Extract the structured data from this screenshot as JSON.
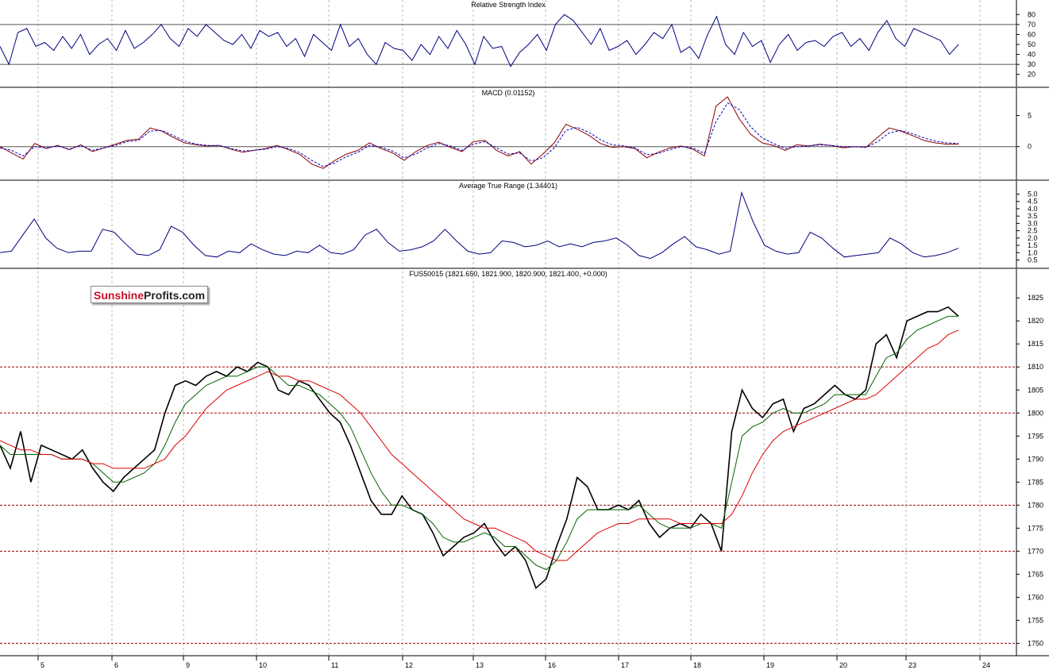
{
  "logo": {
    "part1": "Sunshine",
    "part2": "Profits.com"
  },
  "colors": {
    "price": "#000000",
    "sma_fast": "#006400",
    "sma_slow": "#dd0000",
    "rsi": "#000080",
    "macd": "#8b0000",
    "macd_signal": "#0000cc",
    "atr": "#000080",
    "grid": "#b8b8b8",
    "level": "#a00000",
    "frame": "#000000"
  },
  "chart_data": [
    {
      "type": "line",
      "title": "Relative Strength Index",
      "ylim": [
        15,
        85
      ],
      "y_ticks": [
        "80",
        "70",
        "60",
        "50",
        "40",
        "30",
        "20"
      ],
      "levels": [
        30,
        70
      ],
      "series": [
        {
          "values": [
            48,
            30,
            62,
            66,
            48,
            52,
            44,
            58,
            46,
            60,
            40,
            50,
            56,
            44,
            64,
            46,
            52,
            60,
            70,
            56,
            48,
            66,
            58,
            70,
            62,
            54,
            50,
            60,
            46,
            64,
            58,
            62,
            48,
            56,
            38,
            60,
            52,
            44,
            70,
            48,
            56,
            40,
            30,
            52,
            46,
            44,
            34,
            50,
            40,
            58,
            46,
            64,
            50,
            30,
            58,
            46,
            48,
            28,
            42,
            50,
            60,
            44,
            70,
            80,
            74,
            62,
            50,
            66,
            44,
            48,
            54,
            40,
            50,
            62,
            56,
            70,
            42,
            48,
            36,
            60,
            78,
            50,
            40,
            62,
            48,
            54,
            32,
            50,
            60,
            44,
            52,
            54,
            48,
            58,
            62,
            48,
            56,
            44,
            62,
            74,
            56,
            48,
            66,
            62,
            58,
            54,
            40,
            50
          ]
        }
      ]
    },
    {
      "type": "line",
      "title": "MACD (0.01152)",
      "ylim": [
        -4.5,
        8
      ],
      "y_ticks": [
        "5",
        "0"
      ],
      "levels": [
        0
      ],
      "series": [
        {
          "values": [
            0,
            -1,
            -2,
            0.5,
            -0.3,
            0.2,
            -0.5,
            0.3,
            -0.8,
            -0.2,
            0.4,
            1,
            1.2,
            3,
            2.5,
            1.5,
            0.6,
            0.3,
            0.1,
            0.2,
            -0.4,
            -0.9,
            -0.6,
            -0.3,
            0.2,
            -0.5,
            -1.3,
            -2.8,
            -3.5,
            -2.2,
            -1.2,
            -0.6,
            0.6,
            -0.3,
            -1,
            -2.2,
            -0.8,
            0.2,
            0.7,
            -0.1,
            -0.8,
            0.8,
            1,
            -0.6,
            -1.5,
            -0.8,
            -2.8,
            -1.2,
            0.6,
            3.6,
            2.8,
            1.8,
            0.5,
            -0.1,
            0,
            -0.3,
            -1.8,
            -0.9,
            -0.2,
            0.1,
            -0.4,
            -1.5,
            6.5,
            8,
            4.5,
            2,
            0.6,
            0.2,
            -0.6,
            0.3,
            0.1,
            0.4,
            0.2,
            -0.2,
            0,
            -0.1,
            1.5,
            3,
            2.5,
            1.8,
            1,
            0.6,
            0.4,
            0.4
          ]
        },
        {
          "values": [
            -0.2,
            -0.6,
            -1.5,
            0,
            -0.2,
            0.1,
            -0.4,
            0.2,
            -0.6,
            -0.2,
            0.2,
            0.8,
            1,
            2.5,
            2.6,
            1.8,
            0.9,
            0.4,
            0.2,
            0.2,
            -0.3,
            -0.7,
            -0.6,
            -0.4,
            0,
            -0.3,
            -1,
            -2.2,
            -3.2,
            -2.6,
            -1.6,
            -0.9,
            0.2,
            -0.1,
            -0.7,
            -1.8,
            -1.2,
            -0.2,
            0.5,
            0.1,
            -0.6,
            0.4,
            0.8,
            -0.2,
            -1.2,
            -1,
            -2.3,
            -1.8,
            -0.2,
            2.6,
            3.1,
            2.3,
            1.1,
            0.3,
            0.1,
            -0.2,
            -1.3,
            -1.1,
            -0.5,
            0,
            -0.2,
            -1.1,
            4,
            7,
            6,
            3.2,
            1.4,
            0.5,
            -0.3,
            0,
            0.1,
            0.3,
            0.2,
            0,
            0,
            -0.1,
            0.8,
            2.2,
            2.6,
            2.1,
            1.4,
            0.9,
            0.6,
            0.5
          ]
        }
      ]
    },
    {
      "type": "line",
      "title": "Average True Range (1.34401)",
      "ylim": [
        0.2,
        5.3
      ],
      "y_ticks": [
        "5.0",
        "4.5",
        "4.0",
        "3.5",
        "3.0",
        "2.5",
        "2.0",
        "1.5",
        "1.0",
        "0.5"
      ],
      "series": [
        {
          "values": [
            1.0,
            1.1,
            2.2,
            3.3,
            2.0,
            1.3,
            1.0,
            1.1,
            1.1,
            2.6,
            2.4,
            1.6,
            0.9,
            0.8,
            1.2,
            2.8,
            2.4,
            1.5,
            0.8,
            0.7,
            1.1,
            1.0,
            1.6,
            1.2,
            0.9,
            0.8,
            1.1,
            1.0,
            1.5,
            1.0,
            0.9,
            1.2,
            2.2,
            2.6,
            1.7,
            1.1,
            1.2,
            1.4,
            1.8,
            2.6,
            1.8,
            1.1,
            0.9,
            1.0,
            1.8,
            1.7,
            1.4,
            1.5,
            1.8,
            1.4,
            1.6,
            1.4,
            1.7,
            1.8,
            2.0,
            1.5,
            0.8,
            0.6,
            1.0,
            1.6,
            2.1,
            1.4,
            1.2,
            0.9,
            1.1,
            5.1,
            3.1,
            1.5,
            1.1,
            0.9,
            1.0,
            2.4,
            2.0,
            1.3,
            0.7,
            0.8,
            0.9,
            1.0,
            2.0,
            1.6,
            1.0,
            0.7,
            0.8,
            1.0,
            1.3
          ]
        }
      ]
    },
    {
      "type": "line",
      "title": "FUS50015 (1821.650, 1821.900, 1820.900, 1821.400, +0.000)",
      "ylim": [
        1748,
        1829
      ],
      "y_ticks": [
        "1825",
        "1820",
        "1815",
        "1810",
        "1805",
        "1800",
        "1795",
        "1790",
        "1785",
        "1780",
        "1775",
        "1770",
        "1765",
        "1760",
        "1755",
        "1750"
      ],
      "levels": [
        1810,
        1800,
        1780,
        1770,
        1750
      ],
      "x_ticks": [
        "5",
        "6",
        "9",
        "10",
        "11",
        "12",
        "13",
        "16",
        "17",
        "18",
        "19",
        "20",
        "23",
        "24"
      ],
      "series": [
        {
          "values": [
            1793,
            1788,
            1796,
            1785,
            1793,
            1792,
            1791,
            1790,
            1792,
            1788,
            1785,
            1783,
            1786,
            1788,
            1790,
            1792,
            1800,
            1806,
            1807,
            1806,
            1808,
            1809,
            1808,
            1810,
            1809,
            1811,
            1810,
            1805,
            1804,
            1807,
            1806,
            1803,
            1800,
            1798,
            1793,
            1787,
            1781,
            1778,
            1778,
            1782,
            1779,
            1778,
            1774,
            1769,
            1771,
            1773,
            1774,
            1776,
            1772,
            1769,
            1771,
            1768,
            1762,
            1764,
            1771,
            1777,
            1786,
            1784,
            1779,
            1779,
            1780,
            1779,
            1781,
            1776,
            1773,
            1775,
            1776,
            1775,
            1778,
            1776,
            1770,
            1796,
            1805,
            1801,
            1799,
            1802,
            1803,
            1796,
            1801,
            1802,
            1804,
            1806,
            1804,
            1803,
            1805,
            1815,
            1817,
            1812,
            1820,
            1821,
            1822,
            1822,
            1823,
            1821
          ]
        },
        {
          "values": [
            1793,
            1791,
            1791,
            1791,
            1791,
            1791,
            1790,
            1790,
            1790,
            1789,
            1787,
            1785,
            1785,
            1786,
            1787,
            1789,
            1793,
            1798,
            1802,
            1804,
            1806,
            1807,
            1808,
            1808,
            1809,
            1810,
            1810,
            1808,
            1806,
            1806,
            1805,
            1804,
            1802,
            1800,
            1797,
            1792,
            1787,
            1783,
            1780,
            1780,
            1779,
            1778,
            1776,
            1773,
            1772,
            1772,
            1773,
            1774,
            1773,
            1771,
            1771,
            1769,
            1767,
            1766,
            1768,
            1772,
            1777,
            1779,
            1779,
            1779,
            1779,
            1779,
            1780,
            1778,
            1776,
            1775,
            1775,
            1775,
            1776,
            1776,
            1775,
            1785,
            1795,
            1797,
            1798,
            1800,
            1801,
            1800,
            1800,
            1801,
            1802,
            1804,
            1804,
            1804,
            1804,
            1808,
            1812,
            1813,
            1816,
            1818,
            1819,
            1820,
            1821,
            1821
          ]
        },
        {
          "values": [
            1794,
            1793,
            1792,
            1792,
            1791,
            1791,
            1790,
            1790,
            1790,
            1789,
            1789,
            1788,
            1788,
            1788,
            1788,
            1789,
            1790,
            1793,
            1795,
            1798,
            1801,
            1803,
            1805,
            1806,
            1807,
            1808,
            1809,
            1808,
            1808,
            1807,
            1807,
            1806,
            1805,
            1804,
            1802,
            1800,
            1797,
            1794,
            1791,
            1789,
            1787,
            1785,
            1783,
            1781,
            1779,
            1777,
            1776,
            1775,
            1775,
            1774,
            1773,
            1772,
            1770,
            1769,
            1768,
            1768,
            1770,
            1772,
            1774,
            1775,
            1776,
            1776,
            1777,
            1777,
            1777,
            1777,
            1776,
            1776,
            1776,
            1776,
            1776,
            1778,
            1782,
            1787,
            1791,
            1794,
            1796,
            1797,
            1798,
            1799,
            1800,
            1801,
            1802,
            1803,
            1803,
            1804,
            1806,
            1808,
            1810,
            1812,
            1814,
            1815,
            1817,
            1818
          ]
        }
      ]
    }
  ]
}
